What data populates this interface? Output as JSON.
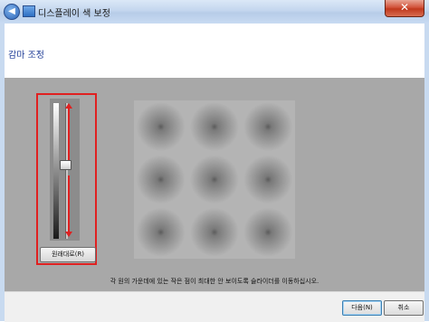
{
  "window": {
    "title": "디스플레이 색 보정",
    "back_icon": "back-arrow-icon",
    "close_label": "✕"
  },
  "page": {
    "title": "감마 조정"
  },
  "gamma_slider": {
    "level": 0.45,
    "restore_label": "원래대로(R)"
  },
  "instruction": "각 원의 가운데에 있는 작은 점이 최대한 안 보이도록 슬라이더를 이동하십시오.",
  "footer": {
    "next_label": "다음(N)",
    "cancel_label": "취소"
  },
  "colors": {
    "highlight": "#e02020",
    "title_text": "#1e3c96",
    "panel_bg": "#a8a8a8"
  }
}
